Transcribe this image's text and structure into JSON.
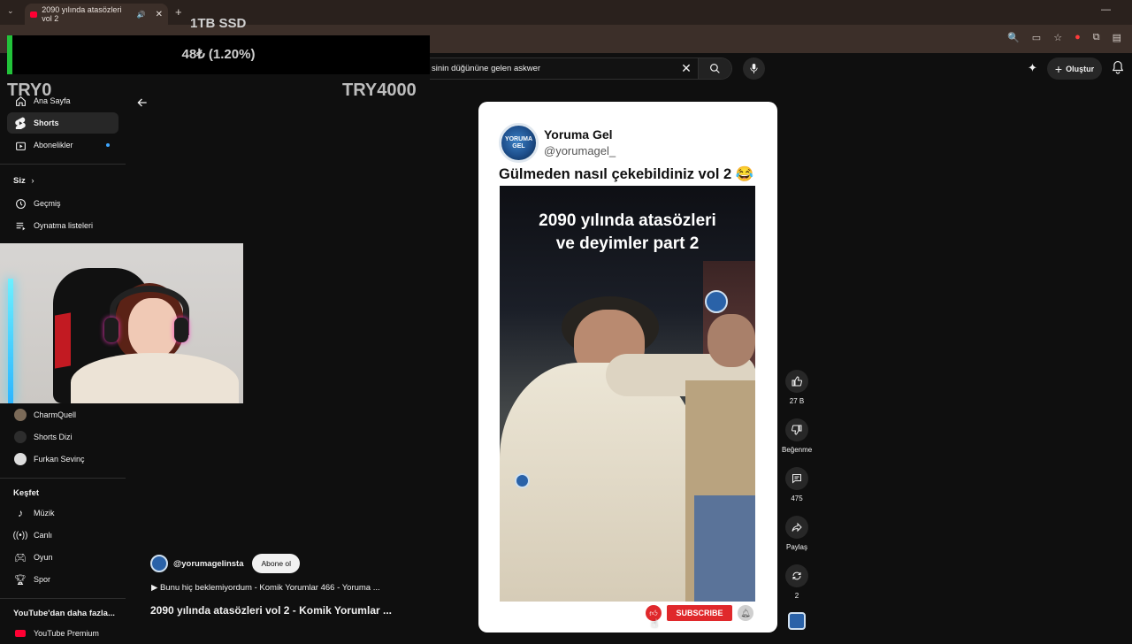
{
  "browser": {
    "tab_title": "2090 yılında atasözleri vol 2"
  },
  "overlay": {
    "title": "1TB SSD",
    "percent": "48₺ (1.20%)",
    "progress": 0.012,
    "min_label": "TRY0",
    "max_label": "TRY4000"
  },
  "header": {
    "search_value": "sinin düğününe gelen askwer",
    "create_label": "Oluştur"
  },
  "sidebar": {
    "items_top": [
      {
        "label": "Ana Sayfa"
      },
      {
        "label": "Shorts"
      },
      {
        "label": "Abonelikler"
      }
    ],
    "you_heading": "Siz",
    "you_items": [
      {
        "label": "Geçmiş"
      },
      {
        "label": "Oynatma listeleri"
      }
    ],
    "subs": [
      {
        "label": "CharmQuell"
      },
      {
        "label": "Shorts Dizi"
      },
      {
        "label": "Furkan Sevinç"
      }
    ],
    "explore_heading": "Keşfet",
    "explore_items": [
      {
        "label": "Müzik"
      },
      {
        "label": "Canlı"
      },
      {
        "label": "Oyun"
      },
      {
        "label": "Spor"
      }
    ],
    "more_heading": "YouTube'dan daha fazla...",
    "premium_label": "YouTube Premium"
  },
  "short": {
    "card_name": "Yoruma Gel",
    "card_handle": "@yorumagel_",
    "card_text": "Gülmeden nasıl çekebildiniz vol 2 😂",
    "avatar_text": "YORUMA GEL",
    "video_title_line1": "2090 yılında atasözleri",
    "video_title_line2": "ve deyimler part 2",
    "subscribe_label": "SUBSCRIBE"
  },
  "actions": {
    "likes": "27 B",
    "dislike_label": "Beğenme",
    "comments": "475",
    "share_label": "Paylaş",
    "remix": "2"
  },
  "info": {
    "channel": "@yorumagelinsta",
    "subscribe_btn": "Abone ol",
    "linked_video": "▶  Bunu hiç beklemiyordum - Komik Yorumlar 466 - Yoruma ...",
    "title": "2090 yılında atasözleri vol 2 - Komik Yorumlar ..."
  }
}
